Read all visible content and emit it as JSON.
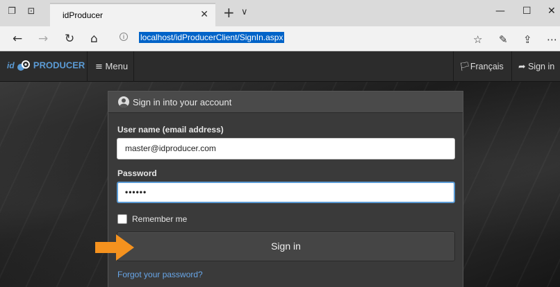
{
  "browser": {
    "tab_title": "idProducer",
    "url": "localhost/idProducerClient/SignIn.aspx",
    "icons": [
      "tab-preview-icon",
      "set-aside-tabs-icon",
      "close-icon",
      "new-tab-icon",
      "tab-list-chevron-icon",
      "minimize-icon",
      "maximize-icon",
      "window-close-icon",
      "back-icon",
      "forward-icon",
      "refresh-icon",
      "home-icon",
      "site-info-icon",
      "favorites-icon",
      "pen-icon",
      "share-icon",
      "more-icon"
    ]
  },
  "navbar": {
    "brand_prefix": "id",
    "brand_name": "PRODUCER",
    "menu_label": "Menu",
    "language_label": "Français",
    "signin_label": "Sign in"
  },
  "signin": {
    "panel_title": "Sign in into your account",
    "username_label": "User name (email address)",
    "username_value": "master@idproducer.com",
    "password_label": "Password",
    "password_value": "••••••",
    "remember_label": "Remember me",
    "remember_checked": false,
    "submit_label": "Sign in",
    "forgot_label": "Forgot your password?"
  },
  "colors": {
    "accent": "#5b9bd5",
    "link": "#68a6e8",
    "pointer_arrow": "#f5921e",
    "url_highlight": "#0063c8"
  }
}
